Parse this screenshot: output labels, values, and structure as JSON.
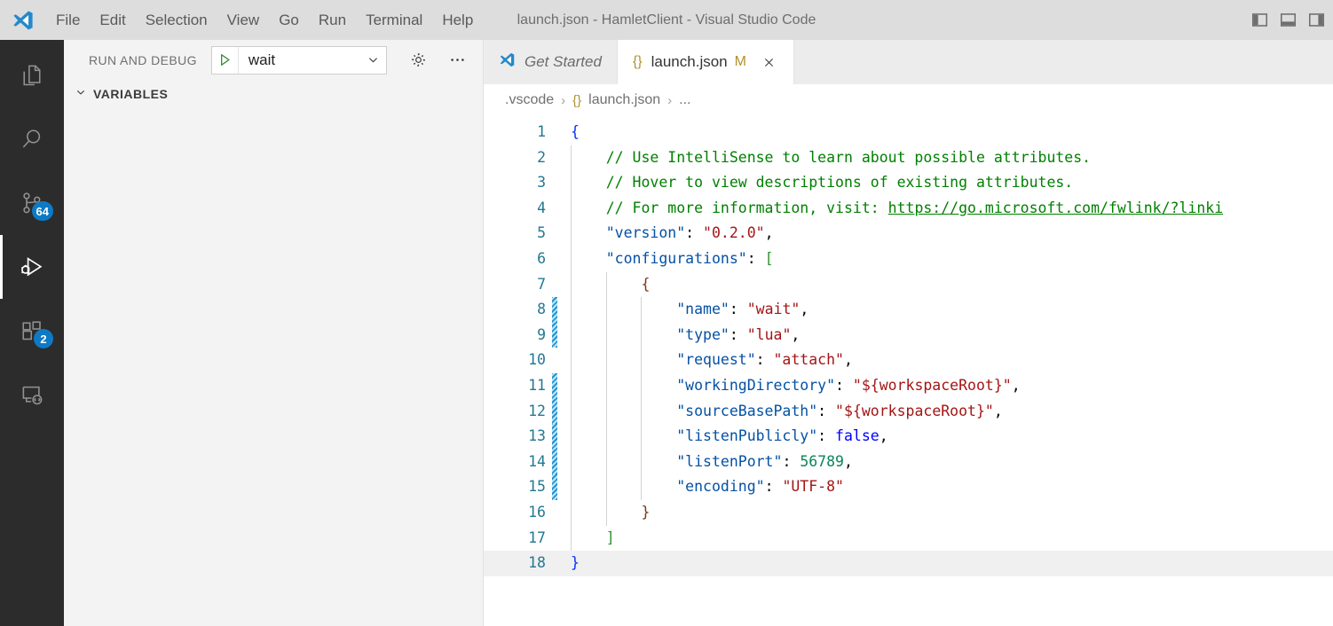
{
  "titlebar": {
    "window_title": "launch.json - HamletClient - Visual Studio Code",
    "menus": [
      "File",
      "Edit",
      "Selection",
      "View",
      "Go",
      "Run",
      "Terminal",
      "Help"
    ],
    "layout_controls": [
      {
        "name": "toggle-primary-sidebar",
        "label": "Toggle Primary Side Bar"
      },
      {
        "name": "toggle-panel",
        "label": "Toggle Panel"
      },
      {
        "name": "toggle-secondary-sidebar",
        "label": "Toggle Secondary Side Bar"
      }
    ]
  },
  "activitybar": {
    "items": [
      {
        "name": "explorer",
        "icon": "files-icon",
        "badge": null,
        "active": false
      },
      {
        "name": "search",
        "icon": "search-icon",
        "badge": null,
        "active": false
      },
      {
        "name": "source-control",
        "icon": "source-control-icon",
        "badge": "64",
        "active": false
      },
      {
        "name": "run-and-debug",
        "icon": "run-and-debug-icon",
        "badge": null,
        "active": true
      },
      {
        "name": "extensions",
        "icon": "extensions-icon",
        "badge": "2",
        "active": false
      },
      {
        "name": "remote-explorer",
        "icon": "remote-explorer-icon",
        "badge": null,
        "active": false
      }
    ]
  },
  "sidebar": {
    "title": "RUN AND DEBUG",
    "launch_config": "wait",
    "run_button_label": "Start Debugging",
    "gear_label": "Open launch.json",
    "more_label": "Views and More Actions...",
    "sections": [
      {
        "name": "variables",
        "label": "VARIABLES",
        "expanded": true
      }
    ]
  },
  "editor": {
    "tabs": [
      {
        "name": "get-started",
        "label": "Get Started",
        "icon": "vscode-icon",
        "active": false,
        "dirty": false
      },
      {
        "name": "launch-json",
        "label": "launch.json",
        "icon": "json-icon",
        "active": true,
        "dirty": true,
        "dirty_marker": "M"
      }
    ],
    "breadcrumbs": [
      ".vscode",
      "launch.json",
      "..."
    ],
    "current_line": 18
  },
  "code": {
    "language": "json",
    "lines": [
      {
        "n": 1,
        "diff": false,
        "tokens": [
          {
            "c": "brkt1",
            "t": "{"
          }
        ]
      },
      {
        "n": 2,
        "diff": false,
        "tokens": [
          {
            "c": "plain",
            "t": "    "
          },
          {
            "c": "comment",
            "t": "// Use IntelliSense to learn about possible attributes."
          }
        ]
      },
      {
        "n": 3,
        "diff": false,
        "tokens": [
          {
            "c": "plain",
            "t": "    "
          },
          {
            "c": "comment",
            "t": "// Hover to view descriptions of existing attributes."
          }
        ]
      },
      {
        "n": 4,
        "diff": false,
        "tokens": [
          {
            "c": "plain",
            "t": "    "
          },
          {
            "c": "comment",
            "t": "// For more information, visit: "
          },
          {
            "c": "link",
            "t": "https://go.microsoft.com/fwlink/?linki"
          }
        ]
      },
      {
        "n": 5,
        "diff": false,
        "tokens": [
          {
            "c": "plain",
            "t": "    "
          },
          {
            "c": "key",
            "t": "\"version\""
          },
          {
            "c": "plain",
            "t": ": "
          },
          {
            "c": "str",
            "t": "\"0.2.0\""
          },
          {
            "c": "plain",
            "t": ","
          }
        ]
      },
      {
        "n": 6,
        "diff": false,
        "tokens": [
          {
            "c": "plain",
            "t": "    "
          },
          {
            "c": "key",
            "t": "\"configurations\""
          },
          {
            "c": "plain",
            "t": ": "
          },
          {
            "c": "brkt2",
            "t": "["
          }
        ]
      },
      {
        "n": 7,
        "diff": false,
        "tokens": [
          {
            "c": "plain",
            "t": "        "
          },
          {
            "c": "brkt3",
            "t": "{"
          }
        ]
      },
      {
        "n": 8,
        "diff": true,
        "tokens": [
          {
            "c": "plain",
            "t": "            "
          },
          {
            "c": "key",
            "t": "\"name\""
          },
          {
            "c": "plain",
            "t": ": "
          },
          {
            "c": "str",
            "t": "\"wait\""
          },
          {
            "c": "plain",
            "t": ","
          }
        ]
      },
      {
        "n": 9,
        "diff": true,
        "tokens": [
          {
            "c": "plain",
            "t": "            "
          },
          {
            "c": "key",
            "t": "\"type\""
          },
          {
            "c": "plain",
            "t": ": "
          },
          {
            "c": "str",
            "t": "\"lua\""
          },
          {
            "c": "plain",
            "t": ","
          }
        ]
      },
      {
        "n": 10,
        "diff": false,
        "tokens": [
          {
            "c": "plain",
            "t": "            "
          },
          {
            "c": "key",
            "t": "\"request\""
          },
          {
            "c": "plain",
            "t": ": "
          },
          {
            "c": "str",
            "t": "\"attach\""
          },
          {
            "c": "plain",
            "t": ","
          }
        ]
      },
      {
        "n": 11,
        "diff": true,
        "tokens": [
          {
            "c": "plain",
            "t": "            "
          },
          {
            "c": "key",
            "t": "\"workingDirectory\""
          },
          {
            "c": "plain",
            "t": ": "
          },
          {
            "c": "str",
            "t": "\"${workspaceRoot}\""
          },
          {
            "c": "plain",
            "t": ","
          }
        ]
      },
      {
        "n": 12,
        "diff": true,
        "tokens": [
          {
            "c": "plain",
            "t": "            "
          },
          {
            "c": "key",
            "t": "\"sourceBasePath\""
          },
          {
            "c": "plain",
            "t": ": "
          },
          {
            "c": "str",
            "t": "\"${workspaceRoot}\""
          },
          {
            "c": "plain",
            "t": ","
          }
        ]
      },
      {
        "n": 13,
        "diff": true,
        "tokens": [
          {
            "c": "plain",
            "t": "            "
          },
          {
            "c": "key",
            "t": "\"listenPublicly\""
          },
          {
            "c": "plain",
            "t": ": "
          },
          {
            "c": "bool",
            "t": "false"
          },
          {
            "c": "plain",
            "t": ","
          }
        ]
      },
      {
        "n": 14,
        "diff": true,
        "tokens": [
          {
            "c": "plain",
            "t": "            "
          },
          {
            "c": "key",
            "t": "\"listenPort\""
          },
          {
            "c": "plain",
            "t": ": "
          },
          {
            "c": "num",
            "t": "56789"
          },
          {
            "c": "plain",
            "t": ","
          }
        ]
      },
      {
        "n": 15,
        "diff": true,
        "tokens": [
          {
            "c": "plain",
            "t": "            "
          },
          {
            "c": "key",
            "t": "\"encoding\""
          },
          {
            "c": "plain",
            "t": ": "
          },
          {
            "c": "str",
            "t": "\"UTF-8\""
          }
        ]
      },
      {
        "n": 16,
        "diff": false,
        "tokens": [
          {
            "c": "plain",
            "t": "        "
          },
          {
            "c": "brkt3",
            "t": "}"
          }
        ]
      },
      {
        "n": 17,
        "diff": false,
        "tokens": [
          {
            "c": "plain",
            "t": "    "
          },
          {
            "c": "brkt2",
            "t": "]"
          }
        ]
      },
      {
        "n": 18,
        "diff": false,
        "tokens": [
          {
            "c": "brkt1",
            "t": "}"
          }
        ]
      }
    ]
  },
  "colors": {
    "titlebar_bg": "#dddddd",
    "activitybar_bg": "#2c2c2c",
    "sidebar_bg": "#f3f3f3",
    "editor_bg": "#ffffff",
    "tabbar_bg": "#ececec",
    "badge_bg": "#0e7ac4",
    "line_number": "#237893",
    "diff_modified": "#2196d3",
    "current_line_bg": "#f0f0f0",
    "comment": "#008000",
    "json_key": "#0451a5",
    "string": "#a31515",
    "number": "#098658",
    "boolean": "#0000ff"
  }
}
